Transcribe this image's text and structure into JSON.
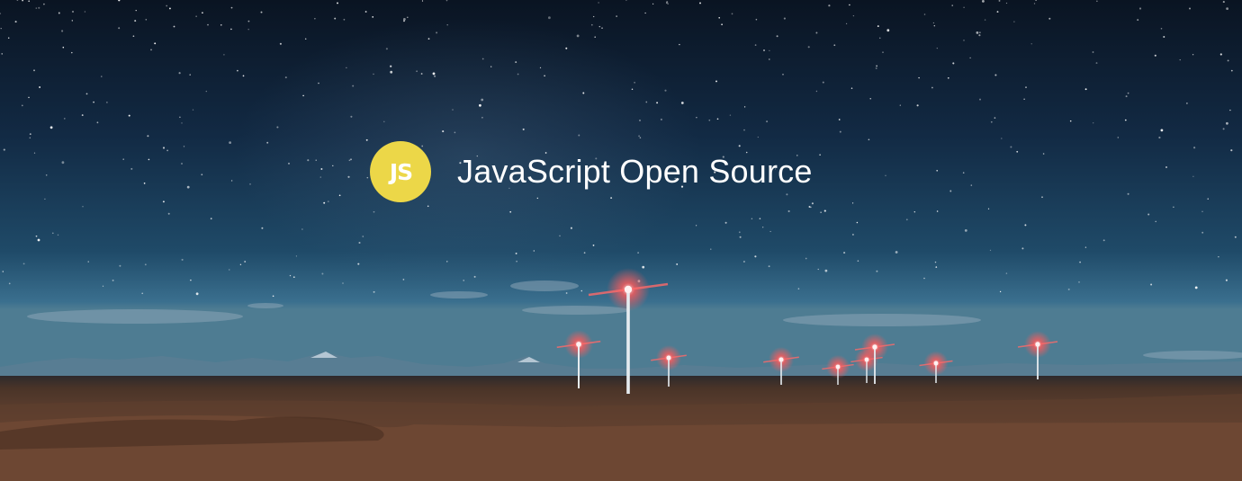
{
  "hero": {
    "logo_text": "JS",
    "title": "JavaScript Open Source"
  },
  "colors": {
    "logo_background": "#ecd748",
    "title_text": "#ffffff",
    "sky_top": "#0a1422",
    "sky_horizon": "#3a6f8e",
    "ground": "#5a3c2c",
    "turbine_light": "#ff5a5a"
  }
}
